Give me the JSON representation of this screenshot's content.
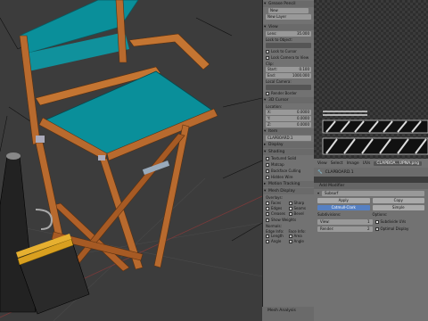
{
  "npanel": {
    "top_label": "Grease Pencil",
    "new_btn": "New",
    "new_layer_btn": "New Layer",
    "view_section": "View",
    "lens_label": "Lens:",
    "lens_value": "35.000",
    "lock_to_object": "Lock to Object:",
    "lock_to_cursor": "Lock to Cursor",
    "lock_camera": "Lock Camera to View",
    "clip_label": "Clip:",
    "clip_start_label": "Start:",
    "clip_start_value": "0.100",
    "clip_end_label": "End:",
    "clip_end_value": "1000.000",
    "local_camera": "Local Camera:",
    "render_border": "Render Border",
    "cursor_section": "3D Cursor",
    "location_label": "Location:",
    "loc_x_label": "X:",
    "loc_x": "0.0000",
    "loc_y_label": "Y:",
    "loc_y": "0.0000",
    "loc_z_label": "Z:",
    "loc_z": "0.0000",
    "item_section": "Item",
    "item_name": "CLAPBOARD.1",
    "display_section": "Display",
    "shading_section": "Shading",
    "textured_solid": "Textured Solid",
    "matcap": "Matcap",
    "backface_culling": "Backface Culling",
    "hidden_wire": "Hidden Wire",
    "motion_tracking": "Motion Tracking",
    "mesh_display": "Mesh Display",
    "overlays_label": "Overlays:",
    "faces": "Faces",
    "sharp": "Sharp",
    "edges": "Edges",
    "seams": "Seams",
    "creases": "Creases",
    "bevel": "Bevel",
    "show_weights": "Show Weights",
    "normals_label": "Normals:",
    "edge_info": "Edge Info:",
    "face_info": "Face Info:",
    "length": "Length",
    "area": "Area",
    "angle": "Angle",
    "angle2": "Angle",
    "mesh_analysis": "Mesh Analysis"
  },
  "uv": {
    "menus": [
      "View",
      "Select",
      "Image",
      "UVs"
    ],
    "image_name": "CLAPBOA...UPNA.png",
    "object_field": "CLAPBOARD.1"
  },
  "props": {
    "add_modifier": "Add Modifier",
    "modifier_name": "Subsurf",
    "apply": "Apply",
    "copy": "Copy",
    "catmull": "Catmull-Clark",
    "simple": "Simple",
    "subdivisions": "Subdivisions:",
    "view_label": "View:",
    "view_value": "1",
    "render_label": "Render:",
    "render_value": "2",
    "options": "Options:",
    "subdivide_uvs": "Subdivide UVs",
    "optimal_display": "Optimal Display"
  },
  "colors": {
    "seat": "#0a8f9a",
    "wood": "#b86a2e",
    "accent": "#5680c2"
  }
}
